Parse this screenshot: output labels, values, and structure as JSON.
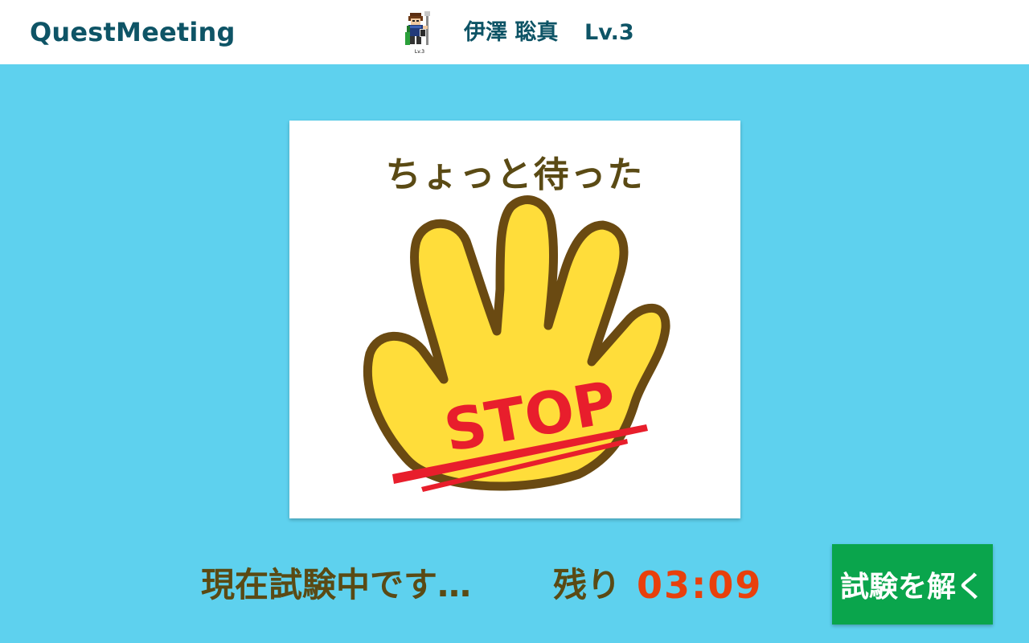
{
  "header": {
    "logo": "QuestMeeting",
    "user_name": "伊澤 聡真",
    "user_level": "Lv.3",
    "avatar_icon": "pixel-hero-avatar-icon",
    "avatar_caption": "Lv.3"
  },
  "card": {
    "title": "ちょっと待った",
    "image_text": "STOP",
    "icon": "stop-hand-icon"
  },
  "footer": {
    "status": "現在試験中です…",
    "remaining_label": "残り",
    "timer": "03:09",
    "solve_button": "試験を解く"
  },
  "colors": {
    "background": "#5ed1ee",
    "brand_text": "#0e5466",
    "heading_brown": "#5a4a14",
    "timer_red": "#e8400c",
    "button_green": "#0aa54c",
    "hand_yellow": "#ffdd3a",
    "hand_outline": "#6a4a12",
    "stop_red": "#e81e2c"
  }
}
